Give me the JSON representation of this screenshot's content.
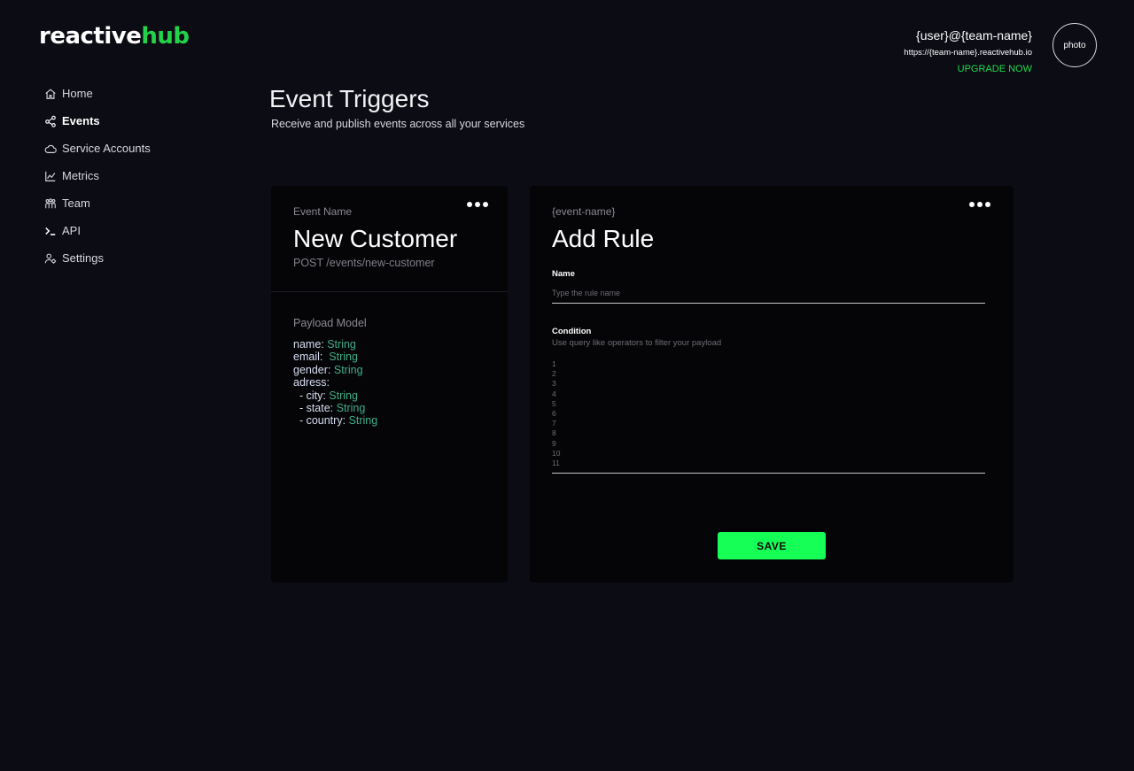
{
  "logo": {
    "part1": "reactive",
    "part2": "hub"
  },
  "sidebar": {
    "items": [
      {
        "label": "Home",
        "icon": "home-icon"
      },
      {
        "label": "Events",
        "icon": "share-nodes-icon",
        "active": true
      },
      {
        "label": "Service Accounts",
        "icon": "cloud-icon"
      },
      {
        "label": "Metrics",
        "icon": "chart-line-icon"
      },
      {
        "label": "Team",
        "icon": "team-icon"
      },
      {
        "label": "API",
        "icon": "terminal-icon"
      },
      {
        "label": "Settings",
        "icon": "user-gear-icon"
      }
    ]
  },
  "header": {
    "user_handle": "{user}@{team-name}",
    "team_url": "https://{team-name}.reactivehub.io",
    "upgrade_label": "UPGRADE NOW",
    "avatar_label": "photo"
  },
  "page": {
    "title": "Event Triggers",
    "subtitle": "Receive and publish events across all your services"
  },
  "event_card": {
    "eyebrow": "Event Name",
    "name": "New Customer",
    "endpoint": "POST /events/new-customer",
    "payload_title": "Payload Model",
    "payload": [
      {
        "key": "name: ",
        "type": "String"
      },
      {
        "key": "email:  ",
        "type": "String"
      },
      {
        "key": "gender: ",
        "type": "String"
      },
      {
        "key": "adress:",
        "type": ""
      },
      {
        "key": "  - city: ",
        "type": "String"
      },
      {
        "key": "  - state: ",
        "type": "String"
      },
      {
        "key": "  - country: ",
        "type": "String"
      }
    ]
  },
  "rule_card": {
    "eyebrow": "{event-name}",
    "title": "Add Rule",
    "name_label": "Name",
    "name_placeholder": "Type the rule name",
    "name_value": "",
    "condition_label": "Condition",
    "condition_hint": "Use query like operators to filter your payload",
    "line_numbers": [
      "1",
      "2",
      "3",
      "4",
      "5",
      "6",
      "7",
      "8",
      "9",
      "10",
      "11"
    ],
    "save_label": "SAVE"
  },
  "colors": {
    "accent": "#16ff57",
    "type_color": "#3fae86",
    "background": "#0b0c14",
    "card": "#050508"
  }
}
